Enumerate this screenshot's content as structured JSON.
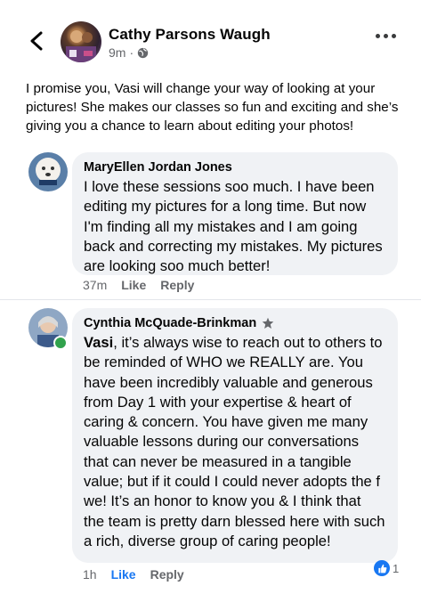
{
  "post": {
    "author": "Cathy Parsons Waugh",
    "time": "9m",
    "separator": "·",
    "text": "I promise you, Vasi will change your way of looking at your pictures!  She makes our classes so fun and exciting and she’s giving you a chance to learn about editing your photos!"
  },
  "comments": [
    {
      "name": "MaryEllen Jordan Jones",
      "text": "I love these sessions soo much. I have been editing my pictures for a long time.  But now I'm finding all my mistakes and I am going back and correcting my mistakes. My pictures are looking soo much better!",
      "time": "37m",
      "like_label": "Like",
      "reply_label": "Reply"
    },
    {
      "name": "Cynthia McQuade-Brinkman",
      "mention": "Vasi",
      "text": ", it’s always wise to reach out to others to be reminded of WHO we REALLY are. You have been incredibly valuable and generous from Day 1 with your expertise & heart of caring & concern. You have given me many valuable lessons during our conversations that can never be measured in a tangible value; but if it could I could never adopts the f we! It’s an honor to know you & I think that the team is pretty darn blessed here with such a rich, diverse group of caring people!",
      "time": "1h",
      "like_label": "Like",
      "reply_label": "Reply",
      "reaction_count": "1"
    }
  ],
  "colors": {
    "accent": "#1877f2",
    "bubble": "#f0f2f5",
    "secondary_text": "#65676b",
    "online": "#31a24c"
  },
  "icons": [
    "back-arrow-icon",
    "globe-icon",
    "more-options-icon",
    "top-fan-star-icon",
    "like-reaction-icon"
  ]
}
